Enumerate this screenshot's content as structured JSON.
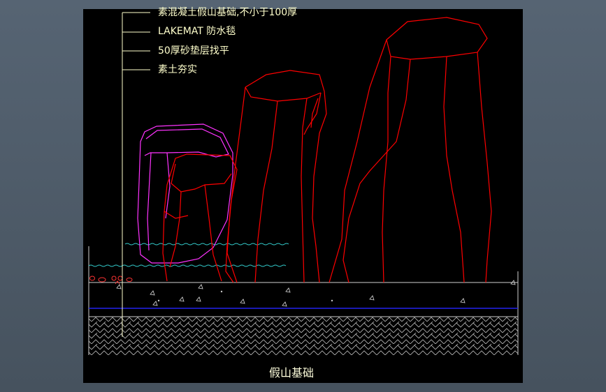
{
  "drawing": {
    "title": "假山基础",
    "callouts": [
      "素混凝土假山基础,不小于100厚",
      "LAKEMAT 防水毯",
      "50厚砂垫层找平",
      "素土夯实"
    ]
  },
  "colors": {
    "rock_outline": "#ff0000",
    "small_rock_outline": "#ff33ff",
    "water_line": "#33cccc",
    "membrane_line": "#2222ee",
    "leader_line": "#ffffcc",
    "label_text": "#ffffcc",
    "ground_hatch": "#bfbfbf",
    "concrete_marks": "#dddddd",
    "canvas_background": "#000000"
  }
}
